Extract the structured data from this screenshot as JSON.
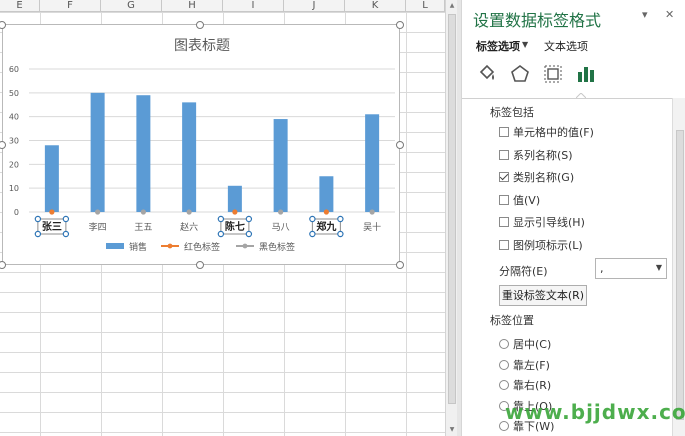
{
  "sheet": {
    "columns": [
      "E",
      "F",
      "G",
      "H",
      "I",
      "J",
      "K",
      "L"
    ]
  },
  "chart_data": {
    "type": "bar",
    "title": "图表标题",
    "categories": [
      "张三",
      "李四",
      "王五",
      "赵六",
      "陈七",
      "马八",
      "郑九",
      "吴十"
    ],
    "series": [
      {
        "name": "销售",
        "type": "bar",
        "values": [
          28,
          50,
          49,
          46,
          11,
          39,
          15,
          41
        ]
      },
      {
        "name": "红色标签",
        "type": "line",
        "values": [
          0,
          null,
          null,
          null,
          0,
          null,
          0,
          null
        ]
      },
      {
        "name": "黑色标签",
        "type": "line",
        "values": [
          null,
          0,
          0,
          0,
          null,
          0,
          null,
          0
        ]
      }
    ],
    "ylim": [
      0,
      60
    ],
    "yticks": [
      0,
      10,
      20,
      30,
      40,
      50,
      60
    ],
    "highlighted_labels": [
      "张三",
      "陈七",
      "郑九"
    ],
    "grid": true,
    "legend": "bottom",
    "colors": {
      "bar": "#5b9bd5",
      "red_label": "#ed7d31",
      "black_label": "#a5a5a5"
    }
  },
  "pane": {
    "title": "设置数据标签格式",
    "tab_label_options": "标签选项",
    "tab_text_options": "文本选项",
    "icons": [
      "fill-icon",
      "shape-outline-icon",
      "size-properties-icon",
      "bar-chart-icon"
    ],
    "section_label_contains": "标签包括",
    "checkboxes": [
      {
        "label": "单元格中的值(F)",
        "checked": false
      },
      {
        "label": "系列名称(S)",
        "checked": false
      },
      {
        "label": "类别名称(G)",
        "checked": true
      },
      {
        "label": "值(V)",
        "checked": false
      },
      {
        "label": "显示引导线(H)",
        "checked": false
      },
      {
        "label": "图例项标示(L)",
        "checked": false
      }
    ],
    "separator_label": "分隔符(E)",
    "separator_value": ",",
    "reset_button": "重设标签文本(R)",
    "section_label_position": "标签位置",
    "radios": [
      {
        "label": "居中(C)"
      },
      {
        "label": "靠左(F)"
      },
      {
        "label": "靠右(R)"
      },
      {
        "label": "靠上(O)"
      },
      {
        "label": "靠下(W)"
      }
    ]
  },
  "watermark": "www.bjjdwx.com",
  "accent": "#217346"
}
